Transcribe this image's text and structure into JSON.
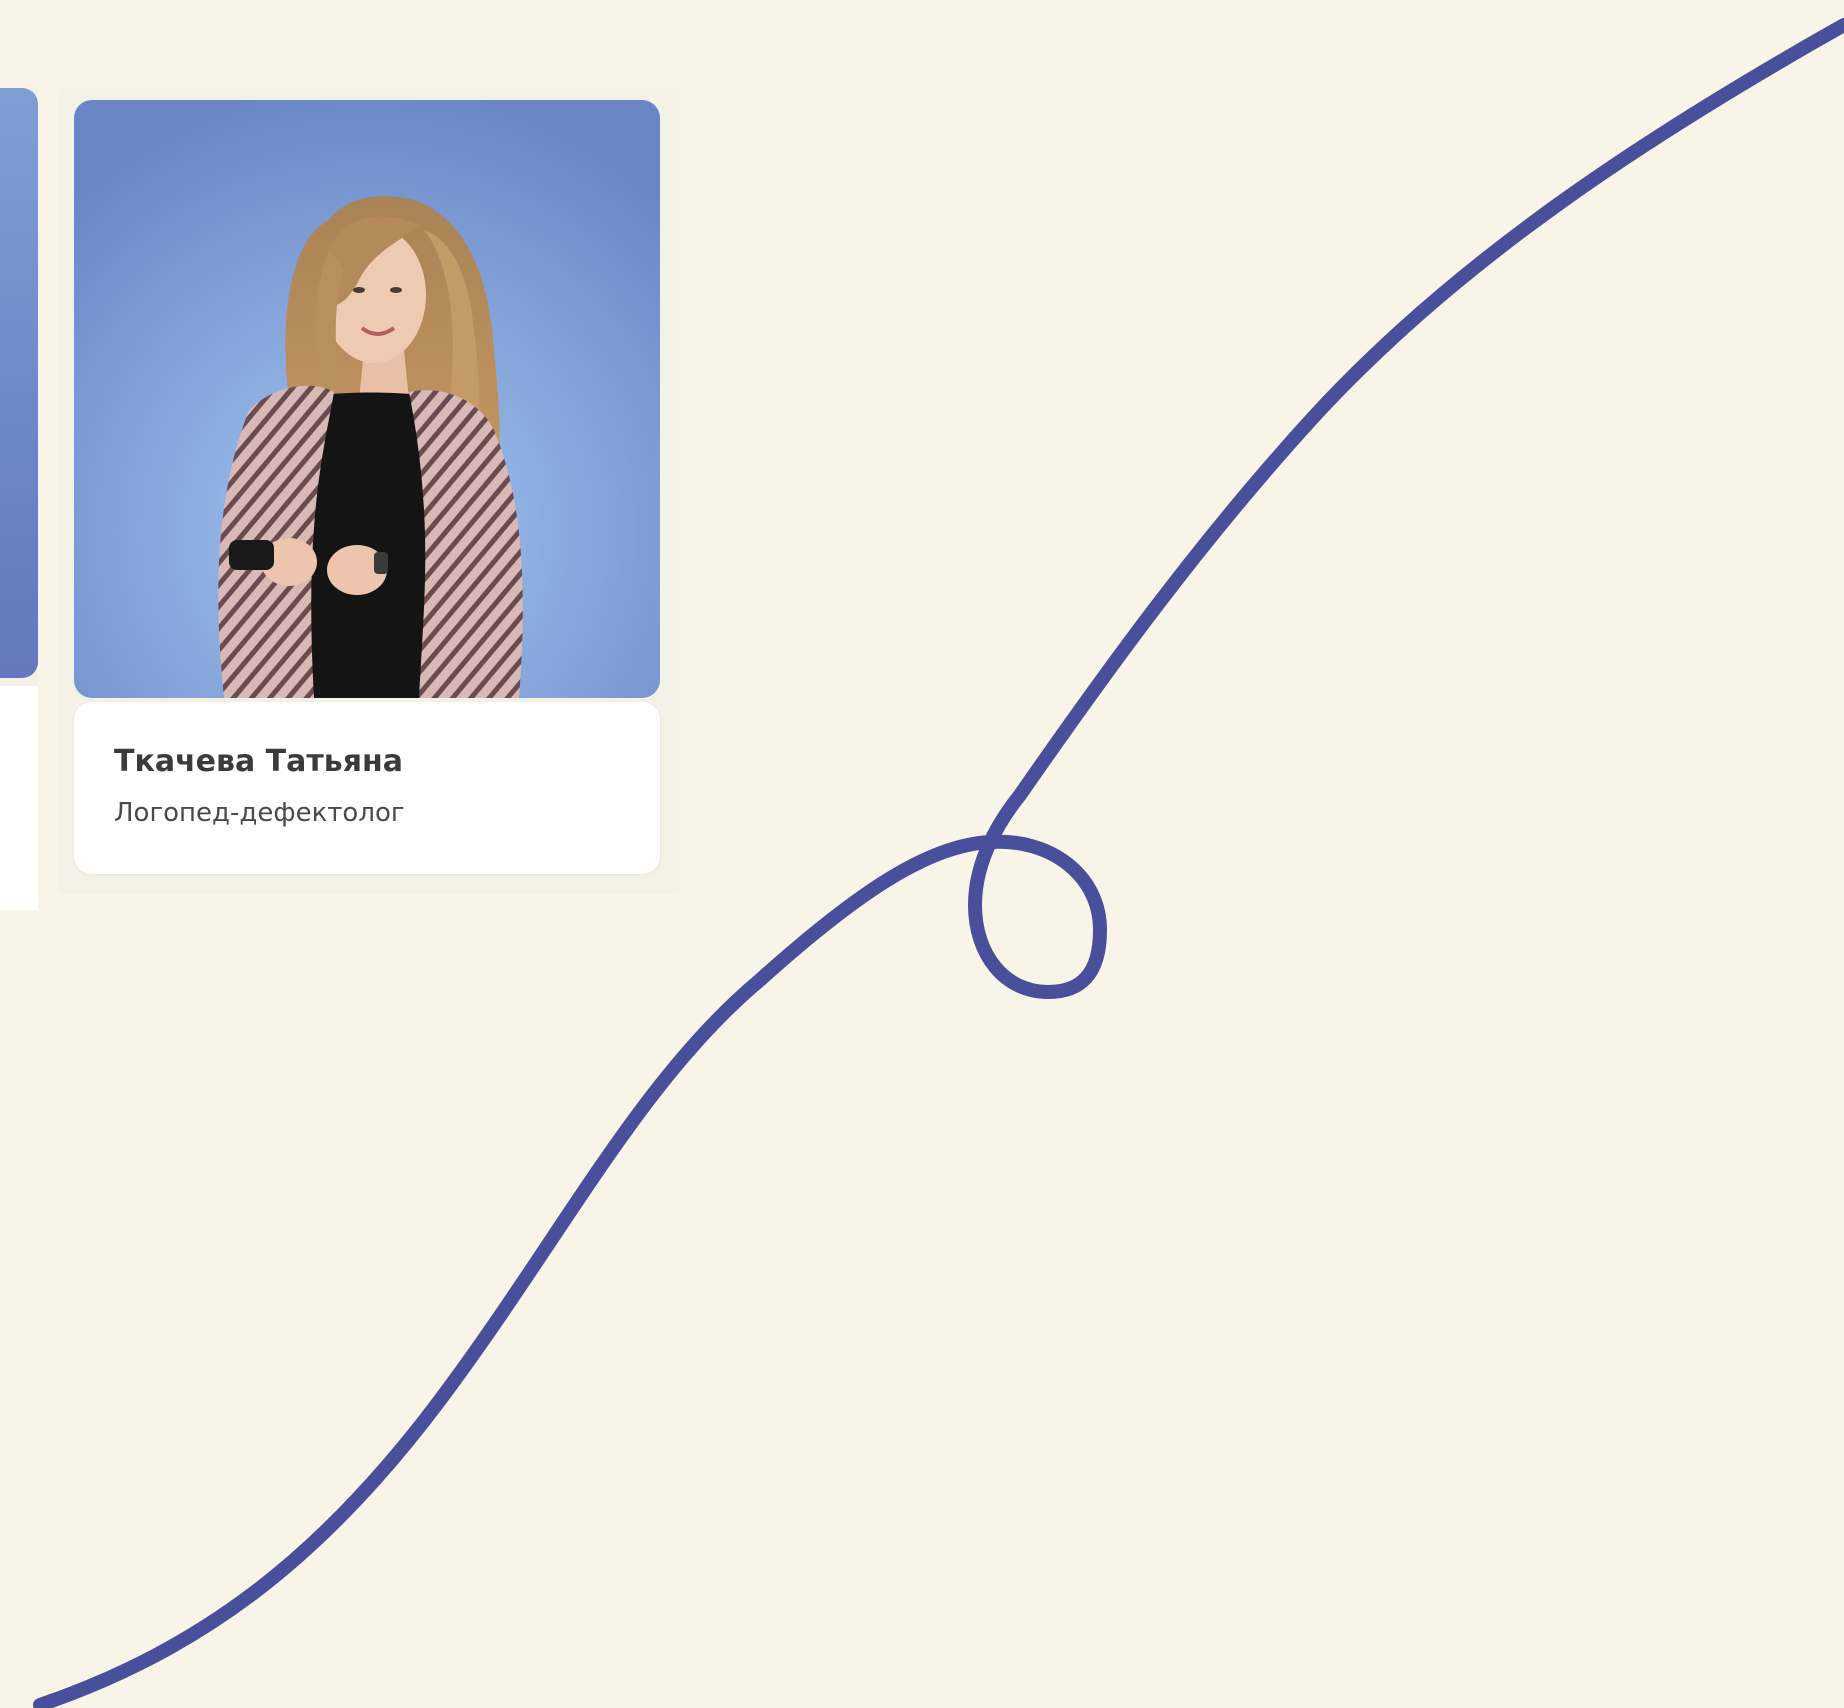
{
  "colors": {
    "page_background": "#f8f5e8",
    "curve_stroke": "#4a4f9c",
    "photo_background": "#7a9bd2",
    "card_body": "#ffffff",
    "name_text": "#3b3b3b",
    "role_text": "#4a4a4a"
  },
  "specialist_card": {
    "name": "Ткачева Татьяна",
    "role": "Логопед-дефектолог",
    "photo_icon": "portrait-photo"
  }
}
